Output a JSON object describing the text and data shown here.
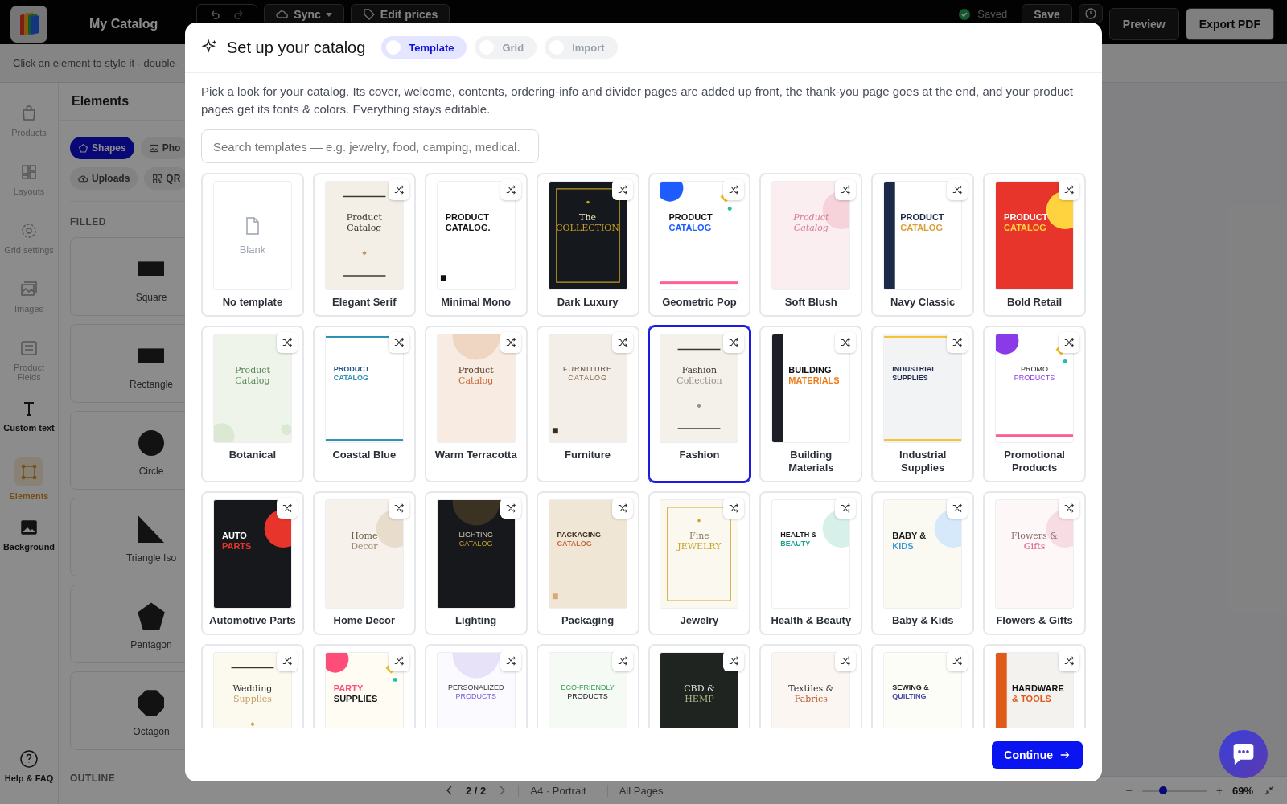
{
  "app": {
    "title": "My Catalog",
    "toolbar": [
      {
        "label": "Sync",
        "kind": "dropdown"
      },
      {
        "label": "Edit prices",
        "kind": "tag"
      }
    ],
    "status": "Saved",
    "save": "Save",
    "preview": "Preview",
    "export": "Export PDF",
    "hint": "Click an element to style it · double-"
  },
  "rail": [
    {
      "label": "Products",
      "disabled": true,
      "selected": false
    },
    {
      "label": "Layouts",
      "disabled": true,
      "selected": false
    },
    {
      "label": "Grid settings",
      "disabled": true,
      "selected": false
    },
    {
      "label": "Images",
      "disabled": true,
      "selected": false
    },
    {
      "label": "Product Fields",
      "disabled": true,
      "selected": false
    },
    {
      "label": "Custom text",
      "disabled": false,
      "selected": false
    },
    {
      "label": "Elements",
      "disabled": false,
      "selected": true
    },
    {
      "label": "Background",
      "disabled": false,
      "selected": false
    }
  ],
  "help": "Help & FAQ",
  "panel": {
    "title": "Elements",
    "chips": [
      {
        "label": "Shapes",
        "selected": true
      },
      {
        "label": "Pho",
        "selected": false
      },
      {
        "label": "Uploads",
        "selected": false
      },
      {
        "label": "QR",
        "selected": false
      }
    ],
    "section": "FILLED",
    "shapes": [
      "Square",
      "Rectangle",
      "Circle",
      "Triangle Iso",
      "Pentagon",
      "Octagon"
    ],
    "section_2": "OUTLINE"
  },
  "pager": {
    "page": "2 / 2",
    "size": "A4 · Portrait",
    "scope": "All Pages",
    "minus": "−",
    "plus": "+",
    "level": 0.33,
    "zoom": "69%"
  },
  "modal": {
    "title": "Set up your catalog",
    "modes": [
      {
        "label": "Template",
        "selected": true
      },
      {
        "label": "Grid",
        "selected": false
      },
      {
        "label": "Import",
        "selected": false
      }
    ],
    "description": "Pick a look for your catalog. Its cover, welcome, contents, ordering-info and divider pages are added up front, the thank-you page goes at the end, and your product pages get its fonts & colors. Everything stays editable.",
    "search": {
      "placeholder": "Search templates — e.g. jewelry, food, camping, medical."
    },
    "templates": [
      {
        "kind": "blank",
        "name": "No template",
        "label": "Blank",
        "selected": false
      },
      {
        "kind": "cover",
        "name": "Elegant Serif",
        "title": "Product Catalog",
        "color": "#f4efe6",
        "selected": false
      },
      {
        "kind": "cover",
        "name": "Minimal Mono",
        "title": "PRODUCT CATALOG.",
        "color": "#ffffff",
        "selected": false
      },
      {
        "kind": "cover",
        "name": "Dark Luxury",
        "title": "The",
        "subtitle": "COLLECTION",
        "color": "#15181d",
        "selected": false
      },
      {
        "kind": "cover",
        "name": "Geometric Pop",
        "title": "PRODUCT",
        "subtitle": "CATALOG",
        "color": "#ffffff",
        "selected": false
      },
      {
        "kind": "cover",
        "name": "Soft Blush",
        "title": "Product",
        "subtitle": "Catalog",
        "color": "#fbeef0",
        "selected": false
      },
      {
        "kind": "cover",
        "name": "Navy Classic",
        "title": "PRODUCT",
        "subtitle": "CATALOG",
        "color": "#ffffff",
        "selected": false
      },
      {
        "kind": "cover",
        "name": "Bold Retail",
        "title": "PRODUCT",
        "subtitle": "CATALOG",
        "color": "#e8352b",
        "selected": false
      },
      {
        "kind": "cover",
        "name": "Botanical",
        "title": "Product",
        "subtitle": "Catalog",
        "color": "#eef4ea",
        "selected": false
      },
      {
        "kind": "cover",
        "name": "Coastal Blue",
        "title": "PRODUCT",
        "subtitle": "CATALOG",
        "color": "#ffffff",
        "selected": false
      },
      {
        "kind": "cover",
        "name": "Warm Terracotta",
        "title": "Product",
        "subtitle": "Catalog",
        "color": "#f8ece2",
        "selected": false
      },
      {
        "kind": "cover",
        "name": "Furniture",
        "title": "FURNITURE",
        "subtitle": "CATALOG",
        "color": "#f3efe8",
        "selected": false
      },
      {
        "kind": "cover",
        "name": "Fashion",
        "title": "Fashion",
        "subtitle": "Collection",
        "color": "#f4f0ea",
        "selected": true
      },
      {
        "kind": "cover",
        "name": "Building Materials",
        "title": "BUILDING",
        "subtitle": "MATERIALS",
        "color": "#ffffff",
        "selected": false
      },
      {
        "kind": "cover",
        "name": "Industrial Supplies",
        "title": "INDUSTRIAL",
        "subtitle": "SUPPLIES",
        "color": "#f2f3f5",
        "selected": false
      },
      {
        "kind": "cover",
        "name": "Promotional Products",
        "title": "PROMO",
        "subtitle": "PRODUCTS",
        "color": "#ffffff",
        "selected": false
      },
      {
        "kind": "cover",
        "name": "Automotive Parts",
        "title": "AUTO",
        "subtitle": "PARTS",
        "color": "#17181c",
        "selected": false
      },
      {
        "kind": "cover",
        "name": "Home Decor",
        "title": "Home",
        "subtitle": "Decor",
        "color": "#f6f1ea",
        "selected": false
      },
      {
        "kind": "cover",
        "name": "Lighting",
        "title": "LIGHTING",
        "subtitle": "CATALOG",
        "color": "#17181c",
        "selected": false
      },
      {
        "kind": "cover",
        "name": "Packaging",
        "title": "PACKAGING",
        "subtitle": "CATALOG",
        "color": "#efe6d6",
        "selected": false
      },
      {
        "kind": "cover",
        "name": "Jewelry",
        "title": "Fine",
        "subtitle": "JEWELRY",
        "color": "#fbf8f0",
        "selected": false
      },
      {
        "kind": "cover",
        "name": "Health & Beauty",
        "title": "HEALTH &",
        "subtitle": "BEAUTY",
        "color": "#ffffff",
        "selected": false
      },
      {
        "kind": "cover",
        "name": "Baby & Kids",
        "title": "BABY &",
        "subtitle": "KIDS",
        "color": "#fbfaf2",
        "selected": false
      },
      {
        "kind": "cover",
        "name": "Flowers & Gifts",
        "title": "Flowers &",
        "subtitle": "Gifts",
        "color": "#fdf7f7",
        "selected": false
      },
      {
        "kind": "cover",
        "title": "Wedding",
        "subtitle": "Supplies",
        "color": "#fcf9ef",
        "selected": false
      },
      {
        "kind": "cover",
        "title": "PARTY",
        "subtitle": "SUPPLIES",
        "color": "#fffdf3",
        "selected": false
      },
      {
        "kind": "cover",
        "title": "PERSONALIZED",
        "subtitle": "PRODUCTS",
        "color": "#fbfbff",
        "selected": false
      },
      {
        "kind": "cover",
        "title": "ECO-FRIENDLY",
        "subtitle": "PRODUCTS",
        "color": "#f6faf4",
        "selected": false
      },
      {
        "kind": "cover",
        "title": "CBD &",
        "subtitle": "HEMP",
        "color": "#1f2420",
        "selected": false
      },
      {
        "kind": "cover",
        "title": "Textiles &",
        "subtitle": "Fabrics",
        "color": "#fbf6f2",
        "selected": false
      },
      {
        "kind": "cover",
        "title": "SEWING &",
        "subtitle": "QUILTING",
        "color": "#fdfdf8",
        "selected": false
      },
      {
        "kind": "cover",
        "title": "HARDWARE",
        "subtitle": "& TOOLS",
        "color": "#f3f2ee",
        "selected": false
      }
    ],
    "continue": "Continue"
  }
}
